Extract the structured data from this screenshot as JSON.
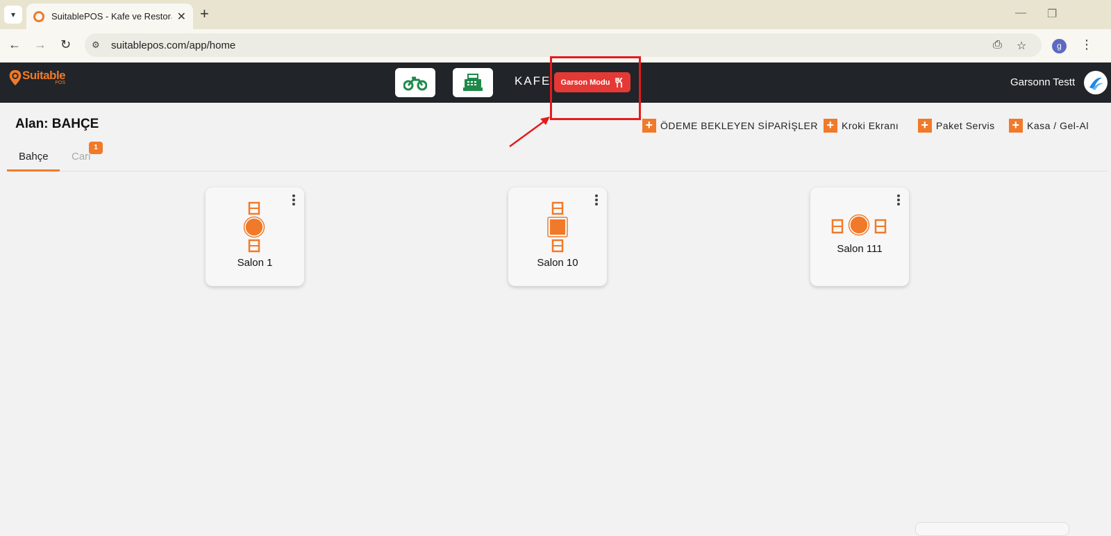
{
  "browser": {
    "tab_title": "SuitablePOS - Kafe ve Restoran",
    "url": "suitablepos.com/app/home",
    "profile_initial": "g"
  },
  "header": {
    "logo_text": "Suitable",
    "logo_sub": "POS",
    "mode_label": "KAFE",
    "waiter_mode_button": "Garson Modu",
    "user_name": "Garsonn Testt"
  },
  "page": {
    "area_title": "Alan: BAHÇE",
    "actions": [
      {
        "label": "ÖDEME BEKLEYEN SİPARİŞLER"
      },
      {
        "label": "Kroki Ekranı"
      },
      {
        "label": "Paket Servis"
      },
      {
        "label": "Kasa / Gel-Al"
      }
    ],
    "tabs": [
      {
        "label": "Bahçe",
        "active": true
      },
      {
        "label": "Cari",
        "active": false,
        "badge": "1"
      }
    ],
    "tables": [
      {
        "name": "Salon 1",
        "shape": "round-vertical"
      },
      {
        "name": "Salon 10",
        "shape": "square-vertical"
      },
      {
        "name": "Salon 111",
        "shape": "round-horizontal"
      }
    ]
  },
  "colors": {
    "accent": "#f07a2a",
    "header_bg": "#212428",
    "waiter_button": "#e53935",
    "annotation": "#e41b1b"
  }
}
